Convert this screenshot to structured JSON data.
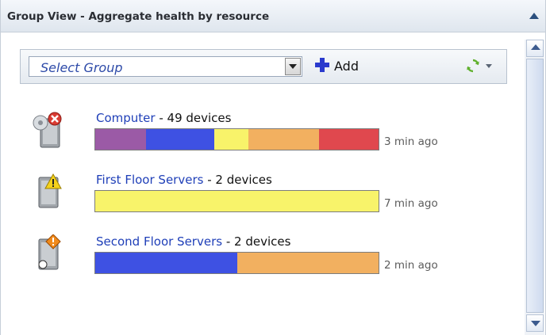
{
  "header": {
    "title": "Group View - Aggregate health by resource"
  },
  "toolbar": {
    "group_select_value": "Select Group",
    "add_label": "Add"
  },
  "groups": [
    {
      "name": "Computer",
      "count_text": " - 49 devices",
      "time": "3 min ago",
      "icon": "server-critical-icon",
      "health": [
        {
          "status": "purple",
          "fraction": 0.18,
          "color": "#9b5aa6"
        },
        {
          "status": "blue",
          "fraction": 0.24,
          "color": "#3e51e3"
        },
        {
          "status": "yellow",
          "fraction": 0.12,
          "color": "#f8f36a"
        },
        {
          "status": "orange",
          "fraction": 0.25,
          "color": "#f2b060"
        },
        {
          "status": "red",
          "fraction": 0.21,
          "color": "#e0484e"
        }
      ]
    },
    {
      "name": "First Floor Servers",
      "count_text": " - 2 devices",
      "time": "7 min ago",
      "icon": "server-warning-icon",
      "health": [
        {
          "status": "yellow",
          "fraction": 1.0,
          "color": "#f8f36a"
        }
      ]
    },
    {
      "name": "Second Floor Servers",
      "count_text": " - 2 devices",
      "time": "2 min ago",
      "icon": "server-alert-icon",
      "health": [
        {
          "status": "blue",
          "fraction": 0.5,
          "color": "#3e51e3"
        },
        {
          "status": "orange",
          "fraction": 0.5,
          "color": "#f2b060"
        }
      ]
    }
  ]
}
